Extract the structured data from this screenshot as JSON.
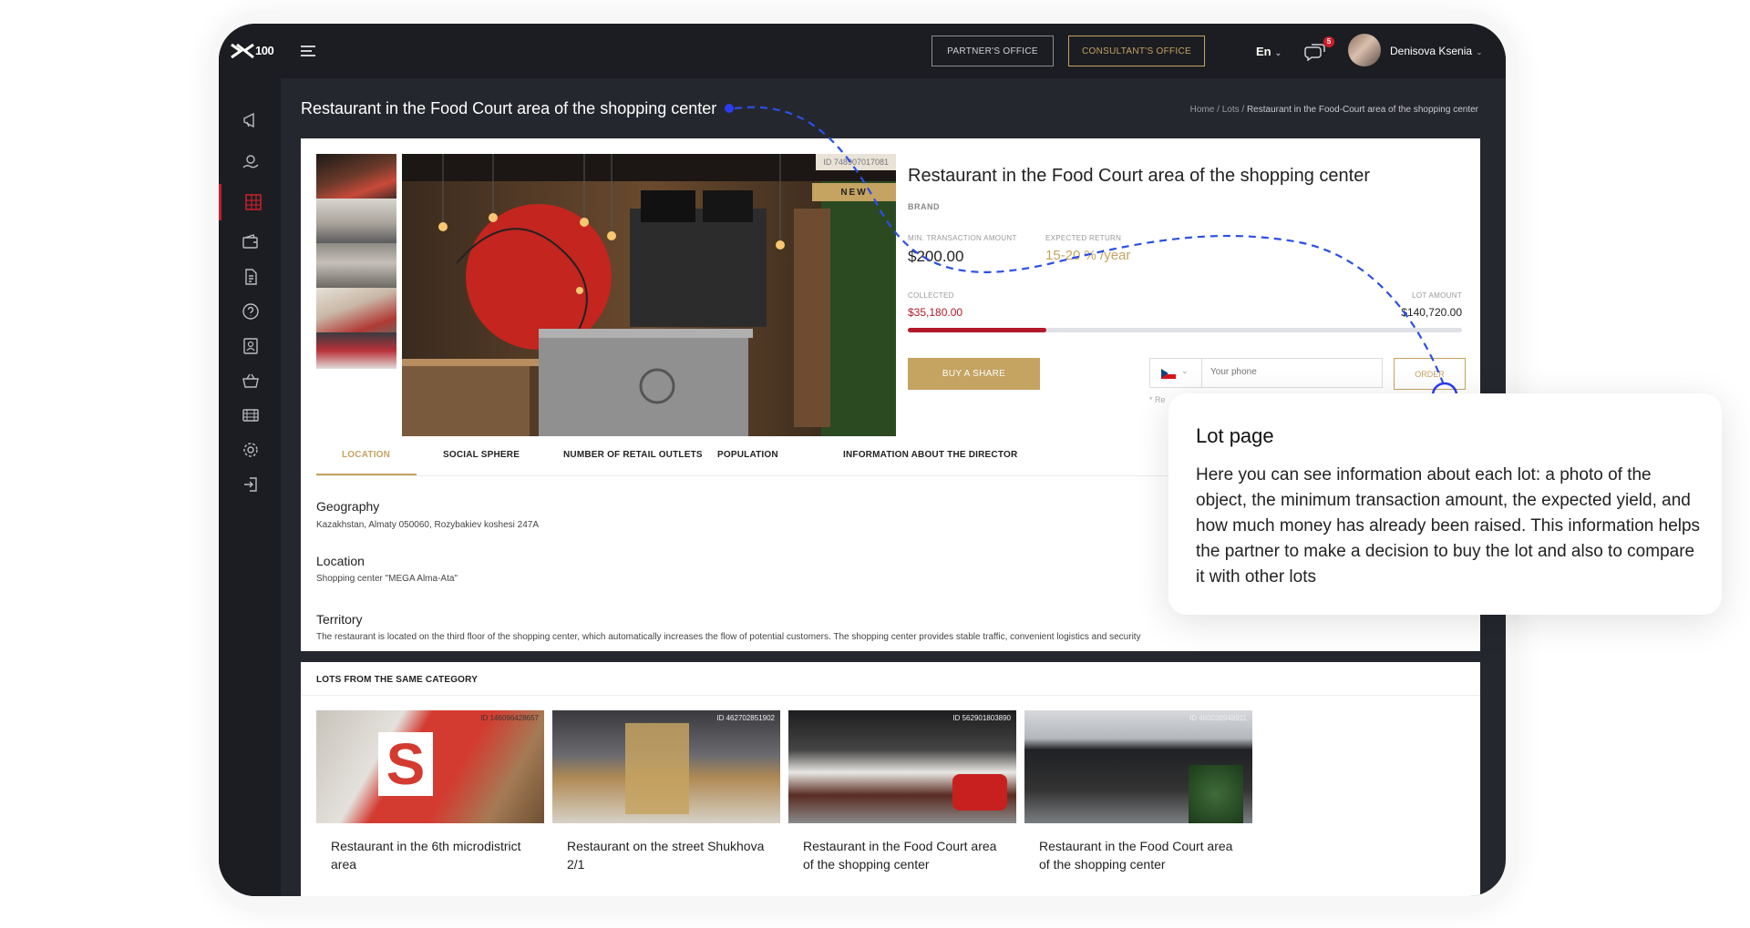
{
  "app": {
    "logo_text": "100"
  },
  "header": {
    "partner_office": "PARTNER'S OFFICE",
    "consultant_office": "CONSULTANT'S OFFICE",
    "language": "En",
    "notifications_count": "5",
    "user_name": "Denisova Ksenia"
  },
  "sidebar": {
    "items": [
      {
        "icon": "megaphone-icon"
      },
      {
        "icon": "coin-hand-icon"
      },
      {
        "icon": "grid-icon",
        "active": true
      },
      {
        "icon": "wallet-icon"
      },
      {
        "icon": "document-icon"
      },
      {
        "icon": "help-icon"
      },
      {
        "icon": "id-card-icon"
      },
      {
        "icon": "cart-icon"
      },
      {
        "icon": "cinema-icon"
      },
      {
        "icon": "settings-icon"
      },
      {
        "icon": "logout-icon"
      }
    ]
  },
  "page": {
    "title": "Restaurant in the Food Court area of the shopping center",
    "breadcrumb": {
      "home": "Home",
      "sep1": " / ",
      "lots": "Lots",
      "sep2": " / ",
      "current": "Restaurant in the Food-Court area of the shopping center"
    }
  },
  "lot": {
    "id": "ID 748907017081",
    "new_badge": "NEW",
    "title": "Restaurant in the Food Court area of the shopping center",
    "brand_label": "BRAND",
    "min_transaction_label": "MIN. TRANSACTION AMOUNT",
    "min_transaction_value": "$200.00",
    "expected_return_label": "EXPECTED RETURN",
    "expected_return_value": "15-20 % /year",
    "collected_label": "COLLECTED",
    "collected_value": "$35,180.00",
    "lot_amount_label": "LOT AMOUNT",
    "lot_amount_value": "$140,720.00",
    "progress_fraction": 0.25,
    "buy_label": "BUY A SHARE",
    "phone_placeholder": "Your phone",
    "order_label": "ORDER",
    "note": "* Re"
  },
  "tabs": [
    {
      "label": "LOCATION",
      "active": true
    },
    {
      "label": "SOCIAL SPHERE"
    },
    {
      "label": "NUMBER OF RETAIL OUTLETS"
    },
    {
      "label": "POPULATION"
    },
    {
      "label": "INFORMATION ABOUT THE DIRECTOR"
    }
  ],
  "info": {
    "geography_title": "Geography",
    "geography_text": "Kazakhstan, Almaty 050060, Rozybakiev koshesi 247A",
    "location_title": "Location",
    "location_text": "Shopping center \"MEGA Alma-Ata\"",
    "territory_title": "Territory",
    "territory_text": "The restaurant is located on the third floor of the shopping center, which automatically increases the flow of potential customers. The shopping center provides stable traffic, convenient logistics and security"
  },
  "related": {
    "heading": "LOTS FROM THE SAME CATEGORY",
    "cards": [
      {
        "id": "ID 146096428657",
        "title": "Restaurant in the 6th microdistrict area"
      },
      {
        "id": "ID 462702851902",
        "title": "Restaurant on the street Shukhova 2/1"
      },
      {
        "id": "ID 562901803890",
        "title": "Restaurant in the Food Court area of the shopping center"
      },
      {
        "id": "ID 460038948911",
        "title": "Restaurant in the Food Court area of the shopping center"
      }
    ]
  },
  "tooltip": {
    "title": "Lot page",
    "body": "Here you can see information about each lot: a photo of the object, the minimum transaction amount, the expected yield, and how much money has already been raised. This information helps the partner to make a decision to buy the lot and also to compare it with other lots"
  },
  "colors": {
    "accent_gold": "#c5a361",
    "accent_red": "#b21a2a",
    "dark_bg": "#25272e",
    "annotation_blue": "#2b4fe6"
  }
}
